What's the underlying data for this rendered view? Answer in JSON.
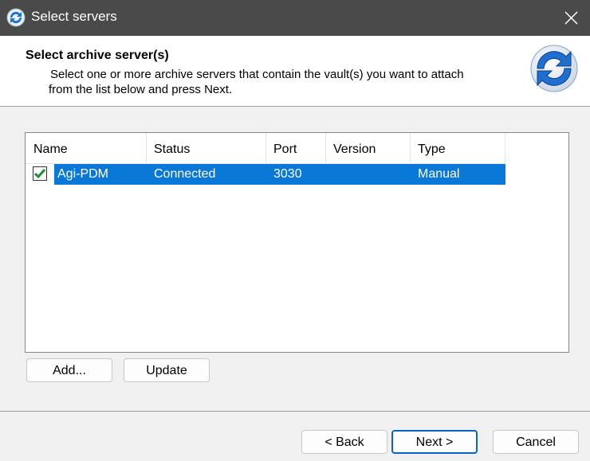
{
  "window": {
    "title": "Select servers",
    "close_icon": "close-icon",
    "app_icon": "sync-arrows-icon"
  },
  "header": {
    "title": "Select archive server(s)",
    "description_line1": "Select one or more archive servers that contain the vault(s) you want to attach",
    "description_line2": "from the list below and press Next.",
    "logo_icon": "sync-arrows-icon"
  },
  "table": {
    "columns": [
      "Name",
      "Status",
      "Port",
      "Version",
      "Type"
    ],
    "rows": [
      {
        "checked": true,
        "name": "Agi-PDM",
        "status": "Connected",
        "port": "3030",
        "version": "",
        "type": "Manual"
      }
    ],
    "selection_color": "#0a78d7"
  },
  "buttons": {
    "add": "Add...",
    "update": "Update",
    "back": "< Back",
    "next": "Next >",
    "cancel": "Cancel"
  },
  "colors": {
    "titlebar": "#4a4a4a",
    "check": "#1e8c2e",
    "logo_blue": "#1f6fd0"
  }
}
